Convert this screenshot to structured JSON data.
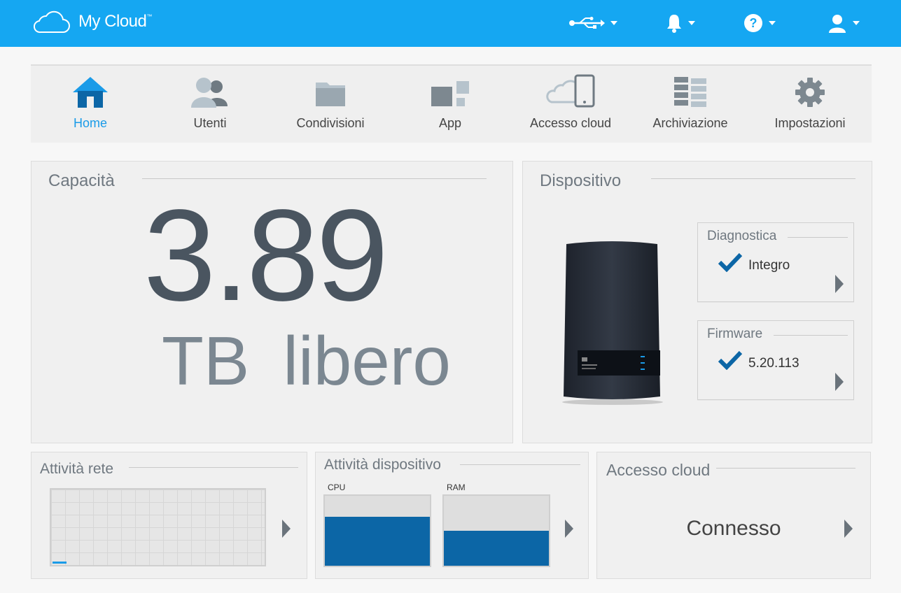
{
  "header": {
    "brand": "My Cloud",
    "tm": "™"
  },
  "nav": {
    "items": [
      {
        "label": "Home",
        "icon": "home-icon",
        "active": true
      },
      {
        "label": "Utenti",
        "icon": "users-icon"
      },
      {
        "label": "Condivisioni",
        "icon": "folder-icon"
      },
      {
        "label": "App",
        "icon": "apps-icon"
      },
      {
        "label": "Accesso cloud",
        "icon": "cloud-access-icon"
      },
      {
        "label": "Archiviazione",
        "icon": "storage-icon"
      },
      {
        "label": "Impostazioni",
        "icon": "gear-icon"
      }
    ]
  },
  "capacity": {
    "title": "Capacità",
    "value": "3.89",
    "unit": "TB",
    "suffix": "libero"
  },
  "device": {
    "title": "Dispositivo",
    "diagnostics": {
      "title": "Diagnostica",
      "value": "Integro"
    },
    "firmware": {
      "title": "Firmware",
      "value": "5.20.113"
    }
  },
  "network": {
    "title": "Attività rete"
  },
  "activity": {
    "title": "Attività dispositivo",
    "cpu_label": "CPU",
    "ram_label": "RAM",
    "cpu_level": 0.7,
    "ram_level": 0.5
  },
  "cloud": {
    "title": "Accesso cloud",
    "status": "Connesso"
  },
  "colors": {
    "accent": "#15a7f2",
    "meter": "#0c66a6"
  }
}
